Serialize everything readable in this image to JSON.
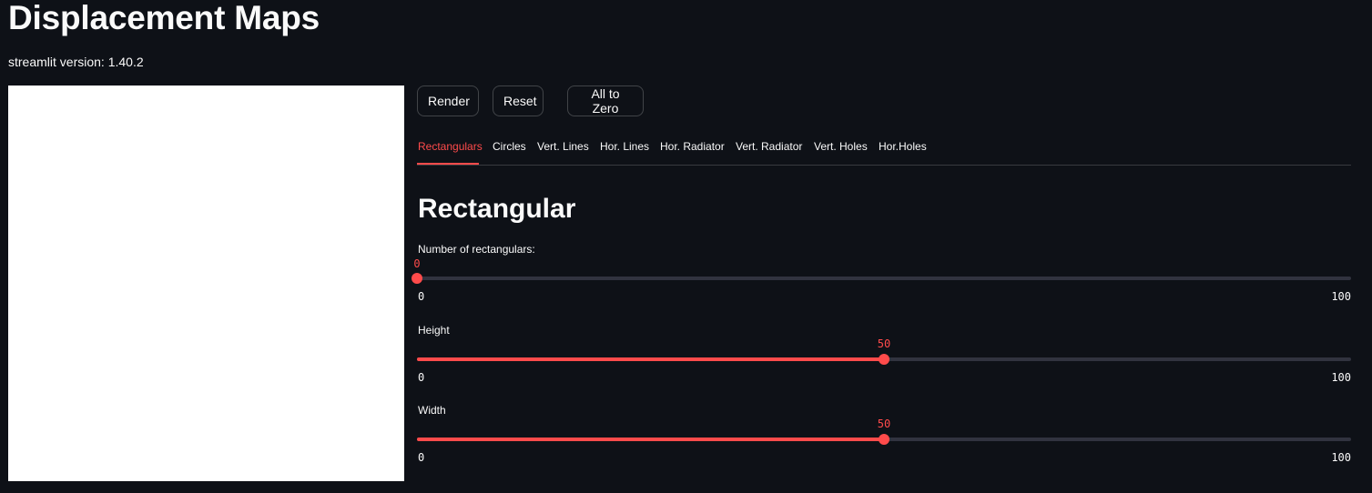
{
  "app": {
    "title": "Displacement Maps",
    "version_text": "streamlit version: 1.40.2"
  },
  "buttons": {
    "render": "Render",
    "reset": "Reset",
    "all_to_zero": "All to Zero"
  },
  "tabs": [
    {
      "label": "Rectangulars",
      "active": true
    },
    {
      "label": "Circles",
      "active": false
    },
    {
      "label": "Vert. Lines",
      "active": false
    },
    {
      "label": "Hor. Lines",
      "active": false
    },
    {
      "label": "Hor. Radiator",
      "active": false
    },
    {
      "label": "Vert. Radiator",
      "active": false
    },
    {
      "label": "Vert. Holes",
      "active": false
    },
    {
      "label": "Hor.Holes",
      "active": false
    }
  ],
  "section": {
    "title": "Rectangular"
  },
  "sliders": [
    {
      "label": "Number of rectangulars:",
      "value": 0,
      "min": 0,
      "max": 100
    },
    {
      "label": "Height",
      "value": 50,
      "min": 0,
      "max": 100
    },
    {
      "label": "Width",
      "value": 50,
      "min": 0,
      "max": 100
    }
  ],
  "colors": {
    "background": "#0e1117",
    "accent": "#ff4b4b",
    "track": "#31333f",
    "canvas": "#ffffff"
  }
}
